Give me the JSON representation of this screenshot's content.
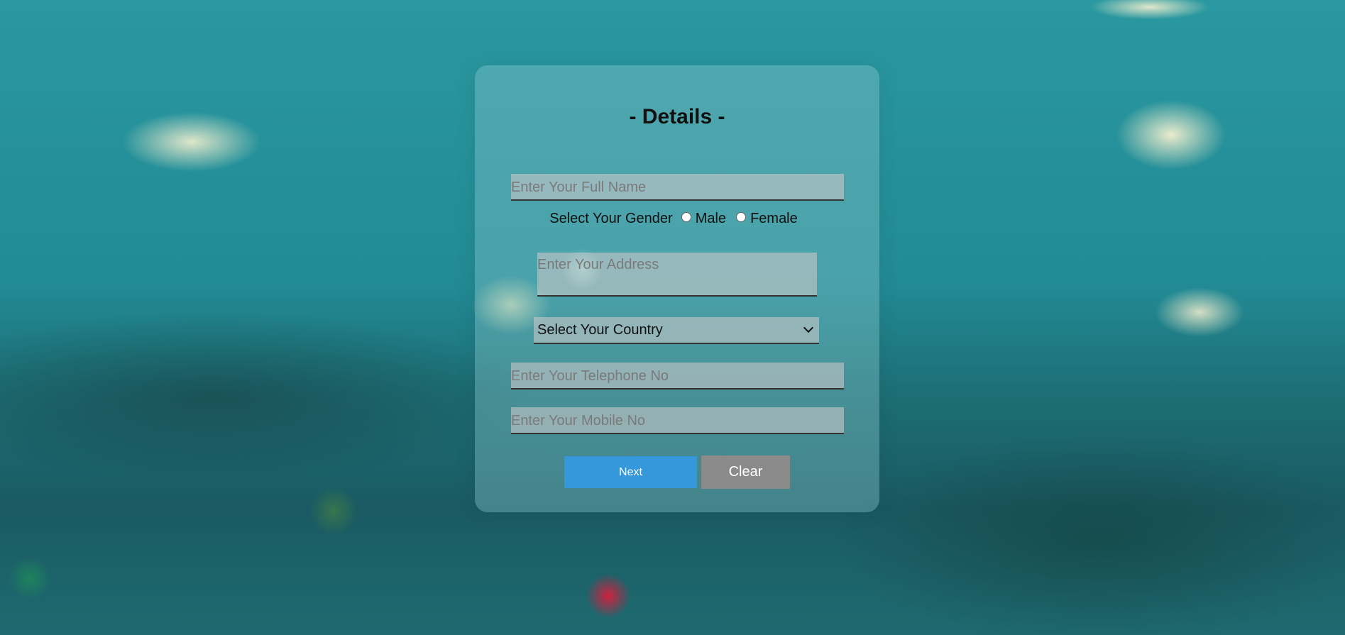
{
  "form": {
    "title": "- Details -",
    "full_name": {
      "placeholder": "Enter Your Full Name",
      "value": ""
    },
    "gender": {
      "label": "Select Your Gender",
      "options": [
        "Male",
        "Female"
      ],
      "selected": null
    },
    "address": {
      "placeholder": "Enter Your Address",
      "value": ""
    },
    "country": {
      "selected": "Select Your Country"
    },
    "telephone": {
      "placeholder": "Enter Your Telephone No",
      "value": ""
    },
    "mobile": {
      "placeholder": "Enter Your Mobile No",
      "value": ""
    },
    "buttons": {
      "next": "Next",
      "clear": "Clear"
    }
  },
  "colors": {
    "next_button": "#3498db",
    "clear_button": "#8a8a8a",
    "background": "#2a8a94"
  }
}
